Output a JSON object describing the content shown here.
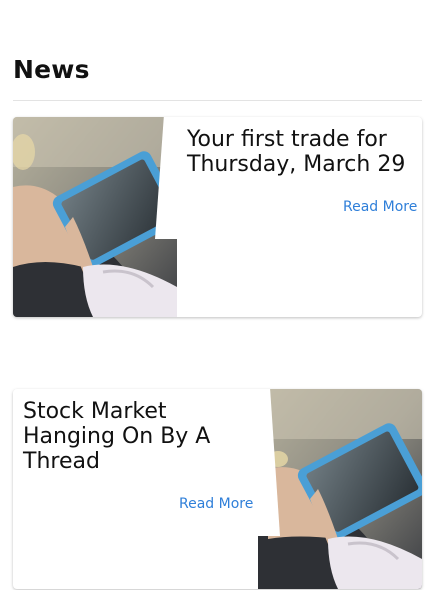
{
  "section": {
    "heading": "News"
  },
  "articles": [
    {
      "title": "Your first trade for Thursday, March 29",
      "read_more": "Read More"
    },
    {
      "title": "Stock Market Hanging On By A Thread",
      "read_more": "Read More"
    }
  ]
}
